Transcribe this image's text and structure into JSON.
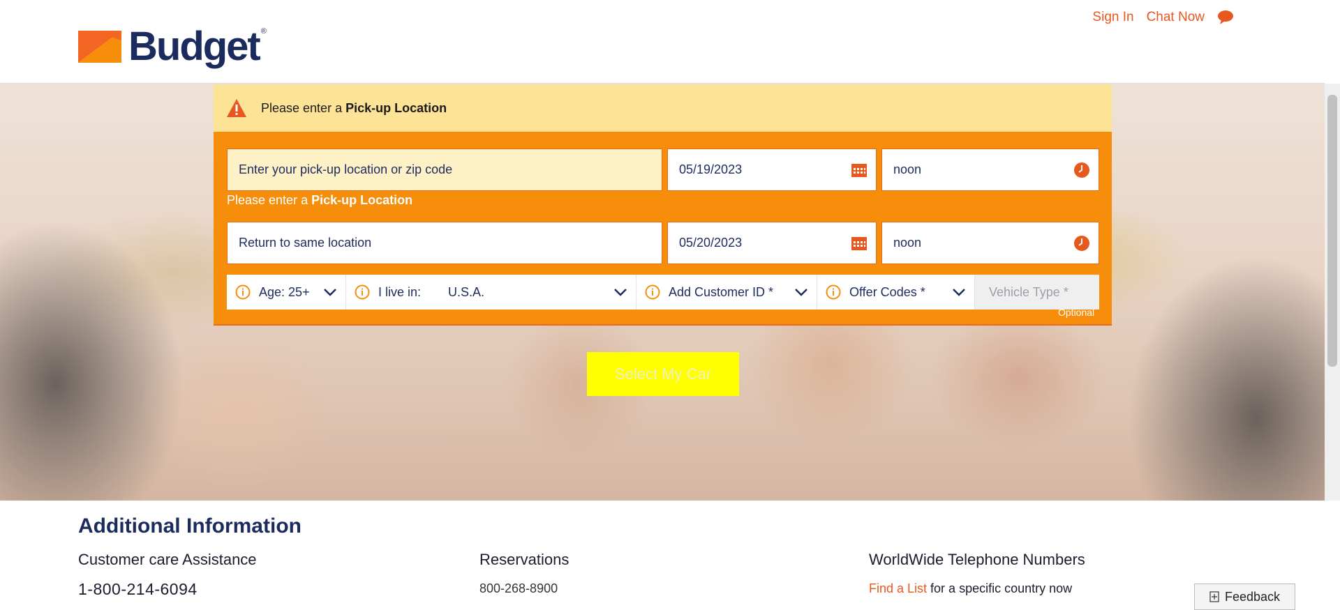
{
  "header": {
    "brand": "Budget",
    "reg_mark": "®",
    "sign_in": "Sign In",
    "chat_now": "Chat Now"
  },
  "alert": {
    "prefix": "Please enter a ",
    "emphasis": "Pick-up Location"
  },
  "booking": {
    "pickup_placeholder": "Enter your pick-up location or zip code",
    "pickup_error_prefix": "Please enter a ",
    "pickup_error_emphasis": "Pick-up Location",
    "pickup_date": "05/19/2023",
    "pickup_time": "noon",
    "return_location": "Return to same location",
    "return_date": "05/20/2023",
    "return_time": "noon",
    "age_label": "Age:",
    "age_value": "25+",
    "live_in_label": "I live in:",
    "live_in_value": "U.S.A.",
    "customer_id": "Add Customer ID *",
    "offer_codes": "Offer Codes *",
    "vehicle_type": "Vehicle Type *",
    "optional": "Optional",
    "cta": "Select My Car"
  },
  "additional": {
    "title": "Additional Information",
    "customer_care_title": "Customer care Assistance",
    "customer_care_phone": "1-800-214-6094",
    "reservations_title": "Reservations",
    "reservations_phone": "800-268-8900",
    "worldwide_title": "WorldWide Telephone Numbers",
    "find_list_link": "Find a List",
    "find_list_suffix": " for a specific country now"
  },
  "feedback": "Feedback",
  "colors": {
    "brand_navy": "#1b2b5e",
    "brand_orange": "#f68e0c",
    "link_orange": "#e8571e",
    "alert_yellow": "#fde395",
    "cta_yellow": "#ffff00"
  }
}
